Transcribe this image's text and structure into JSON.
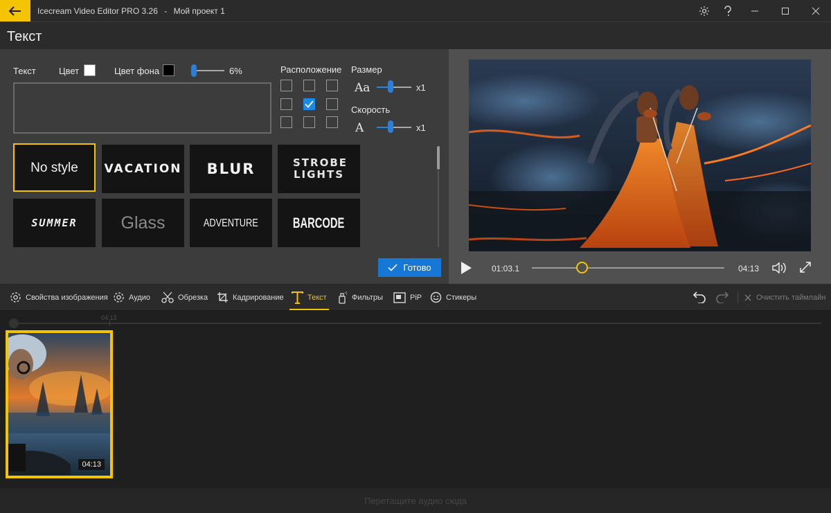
{
  "window": {
    "app_title": "Icecream Video Editor PRO 3.26",
    "separator": "-",
    "project_name": "Мой проект 1"
  },
  "section": {
    "title": "Текст"
  },
  "text_panel": {
    "text_label": "Текст",
    "color_label": "Цвет",
    "color_value": "#ffffff",
    "bg_color_label": "Цвет фона",
    "bg_color_value": "#000000",
    "opacity_value": "6%",
    "opacity_level": 0.06,
    "text_value": "",
    "position_label": "Расположение",
    "position_selected": "middle-center",
    "size_label": "Размер",
    "size_icon_text": "Aa",
    "size_value": "x1",
    "speed_label": "Скорость",
    "speed_icon_text": "A",
    "speed_value": "x1",
    "styles": [
      {
        "label": "No style",
        "selected": true
      },
      {
        "label": "VACATION"
      },
      {
        "label": "BLUR"
      },
      {
        "label": "STROBE LIGHTS"
      },
      {
        "label": "SUMMER"
      },
      {
        "label": "Glass"
      },
      {
        "label": "ADVENTURE"
      },
      {
        "label": "BARCODE"
      }
    ],
    "done_label": "Готово"
  },
  "player": {
    "current_time": "01:03.1",
    "total_time": "04:13",
    "progress": 0.25
  },
  "tools": {
    "image_props": "Свойства изображения",
    "audio": "Аудио",
    "trim": "Обрезка",
    "crop": "Кадрирование",
    "text": "Текст",
    "filters": "Фильтры",
    "pip": "PiP",
    "stickers": "Стикеры",
    "clear_timeline": "Очистить таймлайн",
    "active": "text"
  },
  "timeline": {
    "ruler_mark": "04:13",
    "clip_duration": "04:13"
  },
  "audio_drop": {
    "hint": "Перетащите аудио сюда"
  },
  "colors": {
    "accent": "#f5c400",
    "primary": "#1677d6"
  }
}
